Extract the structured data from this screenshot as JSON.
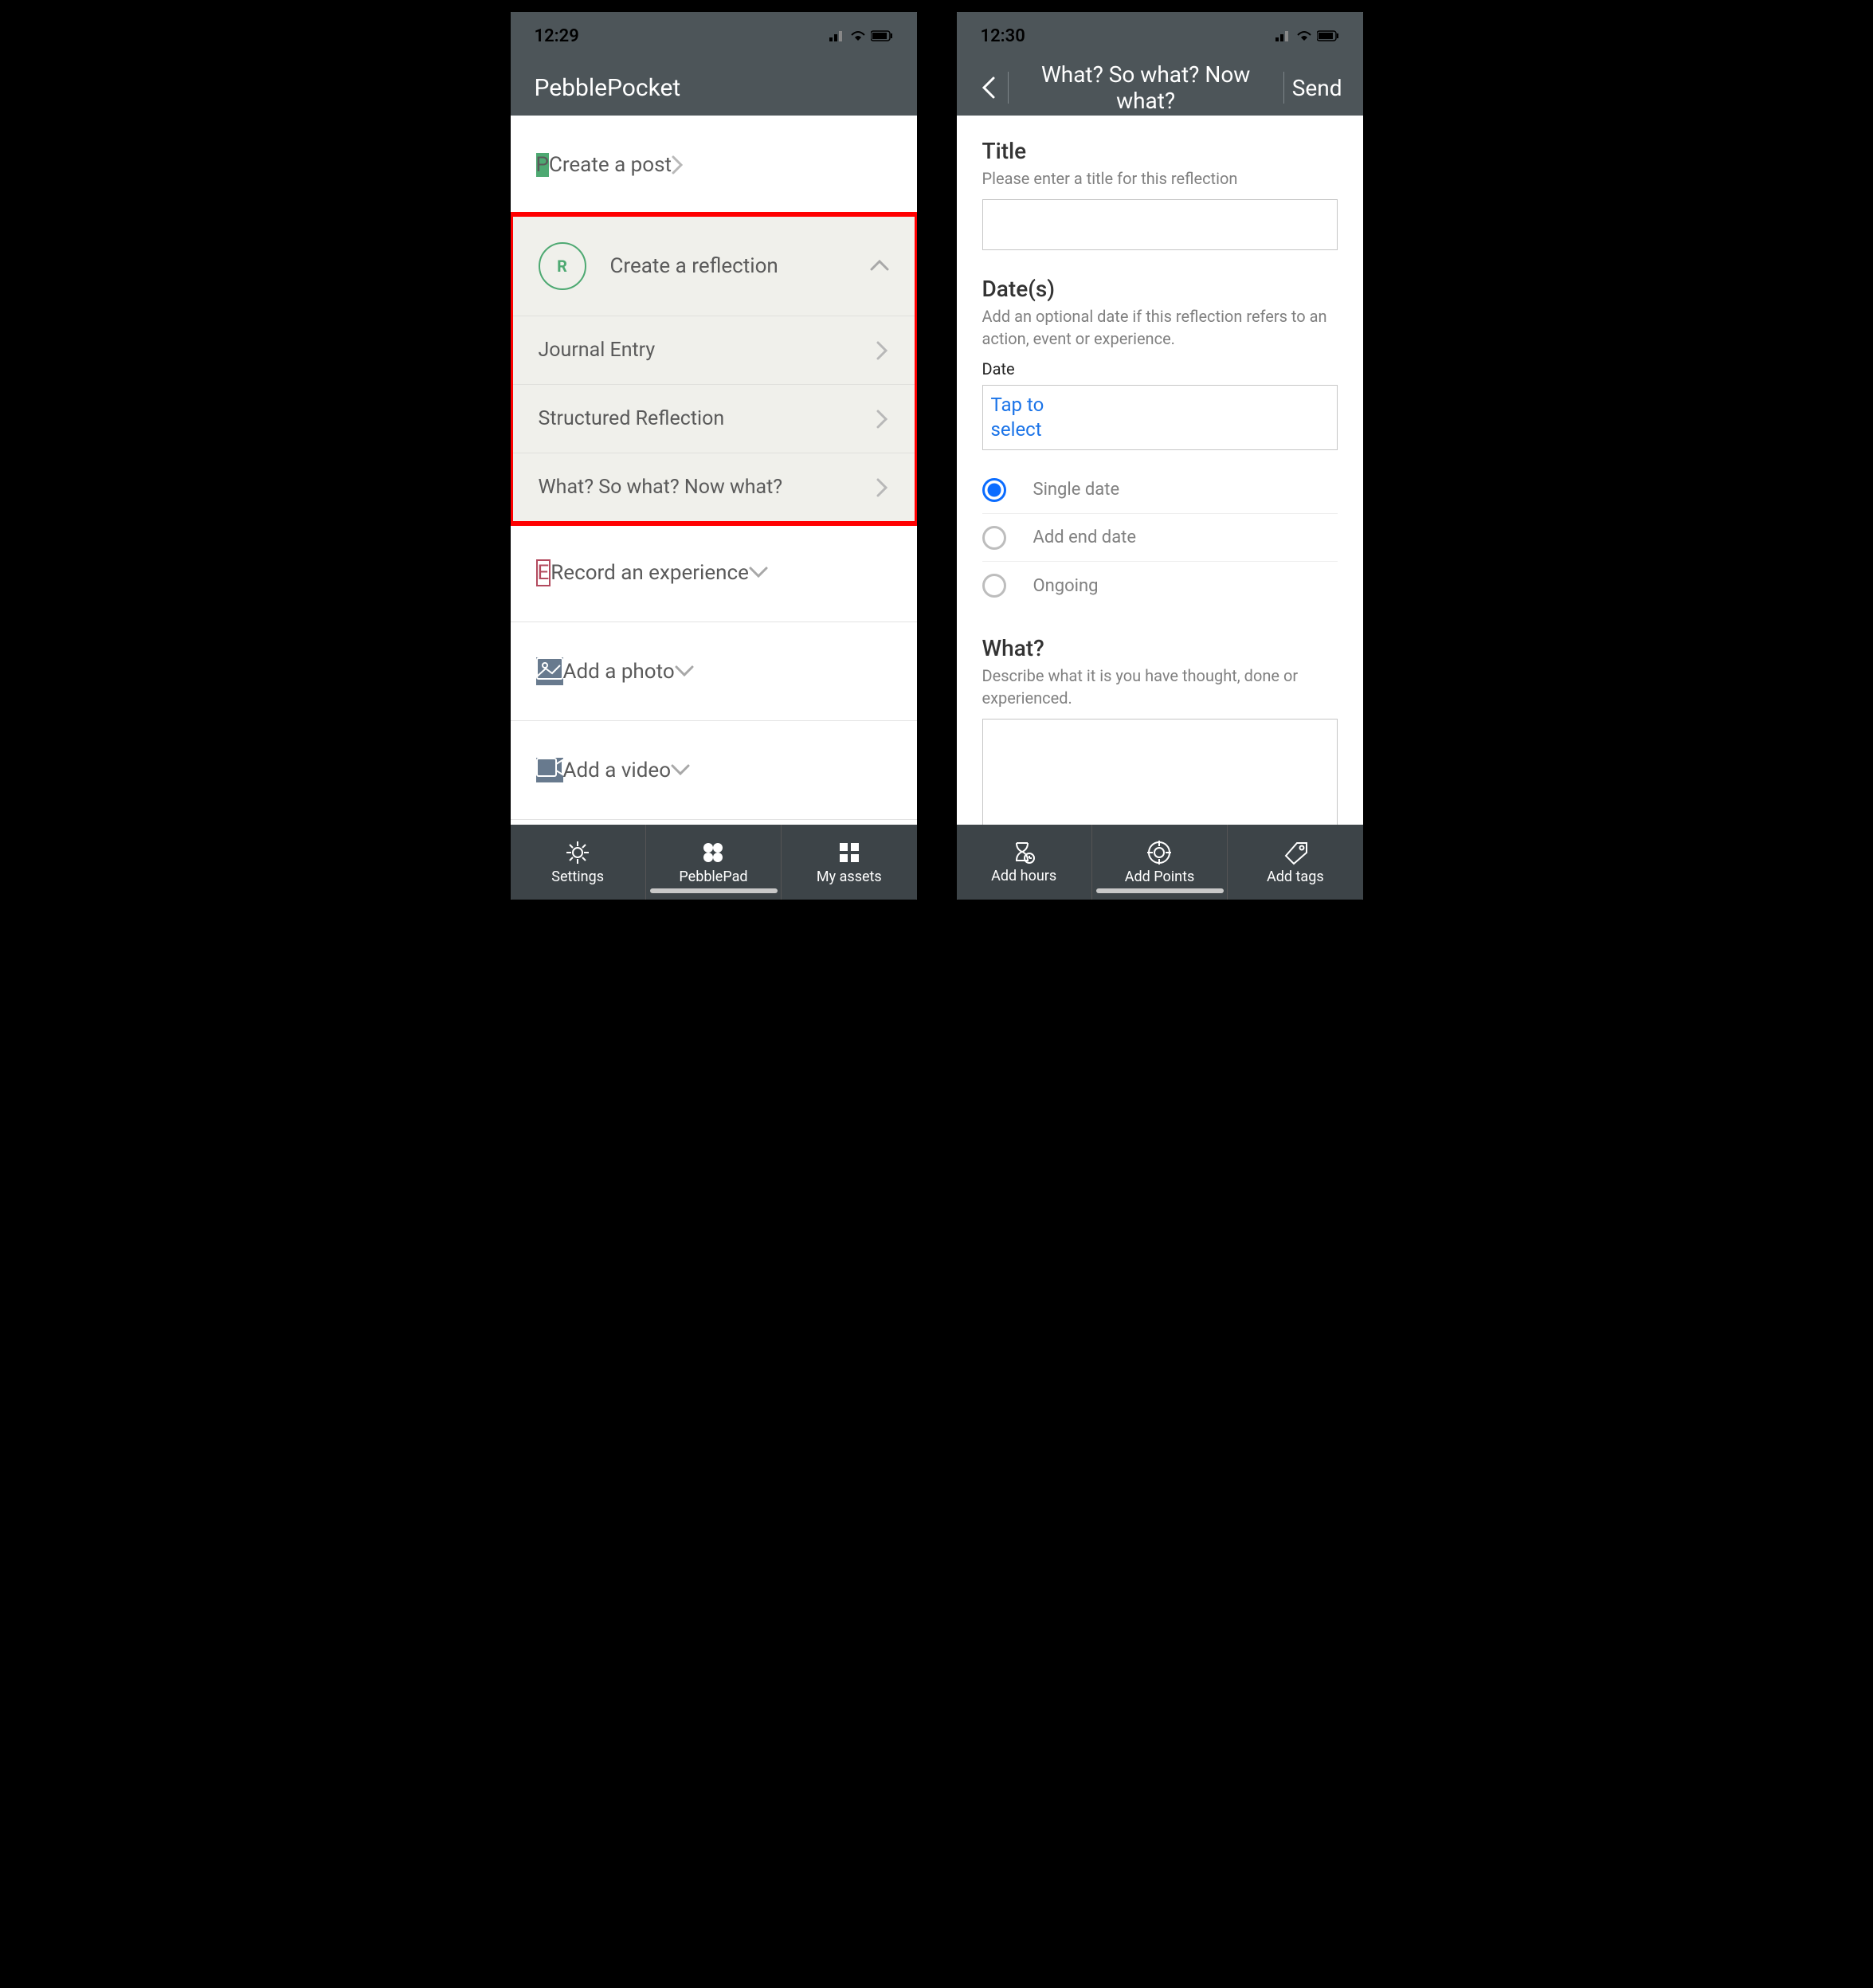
{
  "left": {
    "status_time": "12:29",
    "app_title": "PebblePocket",
    "post_label": "Create a post",
    "reflection_label": "Create a reflection",
    "subitems": {
      "journal": "Journal Entry",
      "structured": "Structured Reflection",
      "whatsowhat": "What? So what? Now what?"
    },
    "experience_label": "Record an experience",
    "photo_label": "Add a photo",
    "video_label": "Add a video",
    "tabs": {
      "settings": "Settings",
      "pebblepad": "PebblePad",
      "assets": "My assets"
    }
  },
  "right": {
    "status_time": "12:30",
    "header_title": "What? So what? Now what?",
    "send_label": "Send",
    "title_heading": "Title",
    "title_hint": "Please enter a title for this reflection",
    "dates_heading": "Date(s)",
    "dates_hint": "Add an optional date if this reflection refers to an action, event or experience.",
    "date_label": "Date",
    "tap_to_select": "Tap to select",
    "radios": {
      "single": "Single date",
      "end": "Add end date",
      "ongoing": "Ongoing"
    },
    "what_heading": "What?",
    "what_hint": "Describe what it is you have thought, done or experienced.",
    "tabs": {
      "hours": "Add hours",
      "points": "Add Points",
      "tags": "Add tags"
    }
  }
}
